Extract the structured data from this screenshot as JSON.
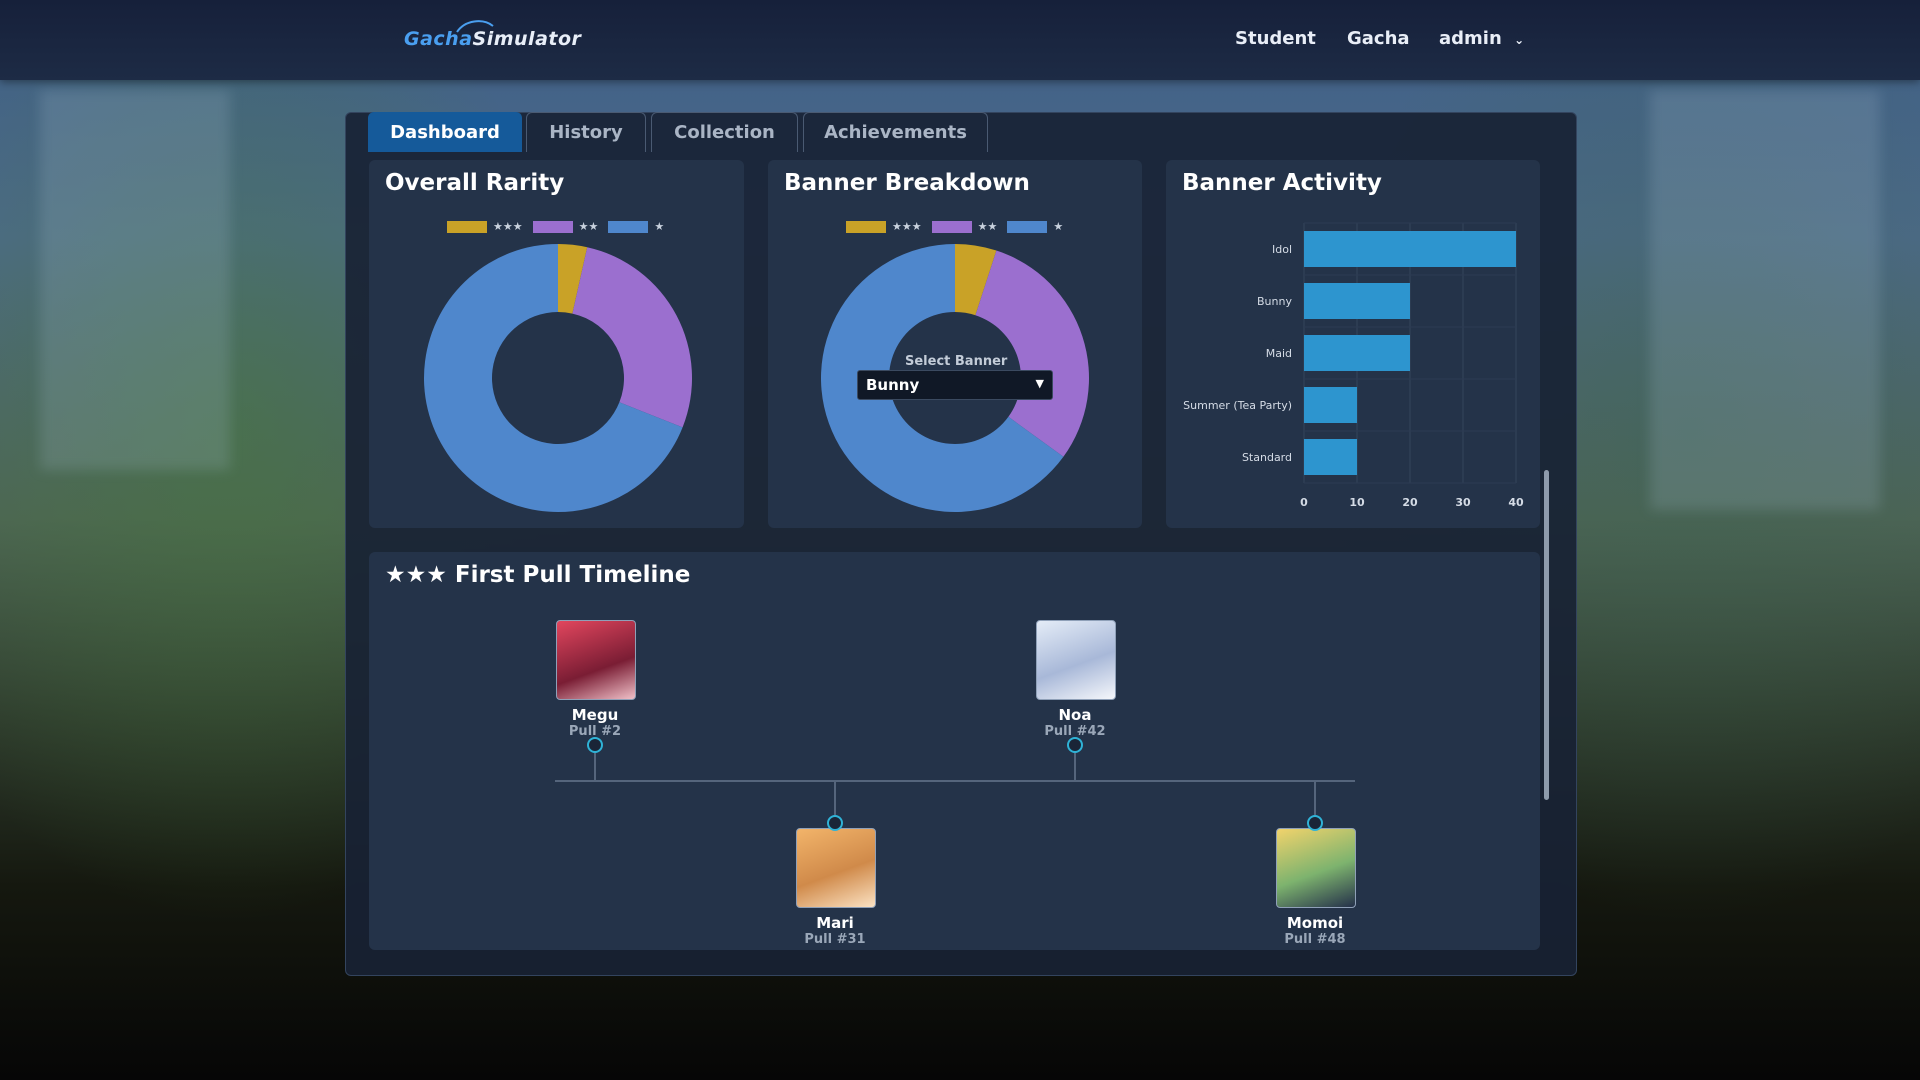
{
  "app": {
    "logo_part1": "Gacha",
    "logo_part2": "Simulator",
    "nav": {
      "student": "Student",
      "gacha": "Gacha",
      "user": "admin"
    }
  },
  "tabs": [
    "Dashboard",
    "History",
    "Collection",
    "Achievements"
  ],
  "active_tab": "Dashboard",
  "colors": {
    "three_star": "#c9a227",
    "two_star": "#9b6fcf",
    "one_star": "#4f87cc",
    "bar": "#2d95cf",
    "accent": "#155a9a"
  },
  "legend": {
    "three_star": "★★★",
    "two_star": "★★",
    "one_star": "★"
  },
  "overall_rarity": {
    "title": "Overall Rarity"
  },
  "banner_breakdown": {
    "title": "Banner Breakdown",
    "select_label": "Select Banner",
    "selected": "Bunny"
  },
  "banner_activity": {
    "title": "Banner Activity"
  },
  "chart_data": [
    {
      "type": "pie",
      "title": "Overall Rarity",
      "categories": [
        "★★★",
        "★★",
        "★"
      ],
      "values": [
        3.5,
        27.5,
        69
      ]
    },
    {
      "type": "pie",
      "title": "Banner Breakdown",
      "categories": [
        "★★★",
        "★★",
        "★"
      ],
      "values": [
        5,
        30,
        65
      ]
    },
    {
      "type": "bar",
      "title": "Banner Activity",
      "orientation": "horizontal",
      "categories": [
        "Idol",
        "Bunny",
        "Maid",
        "Summer (Tea Party)",
        "Standard"
      ],
      "values": [
        40,
        20,
        20,
        10,
        10
      ],
      "xlim": [
        0,
        40
      ],
      "xticks": [
        0,
        10,
        20,
        30,
        40
      ],
      "grid": true
    }
  ],
  "timeline": {
    "title": "★★★ First Pull Timeline",
    "items": [
      {
        "name": "Megu",
        "pull": "Pull #2"
      },
      {
        "name": "Mari",
        "pull": "Pull #31"
      },
      {
        "name": "Noa",
        "pull": "Pull #42"
      },
      {
        "name": "Momoi",
        "pull": "Pull #48"
      }
    ]
  }
}
